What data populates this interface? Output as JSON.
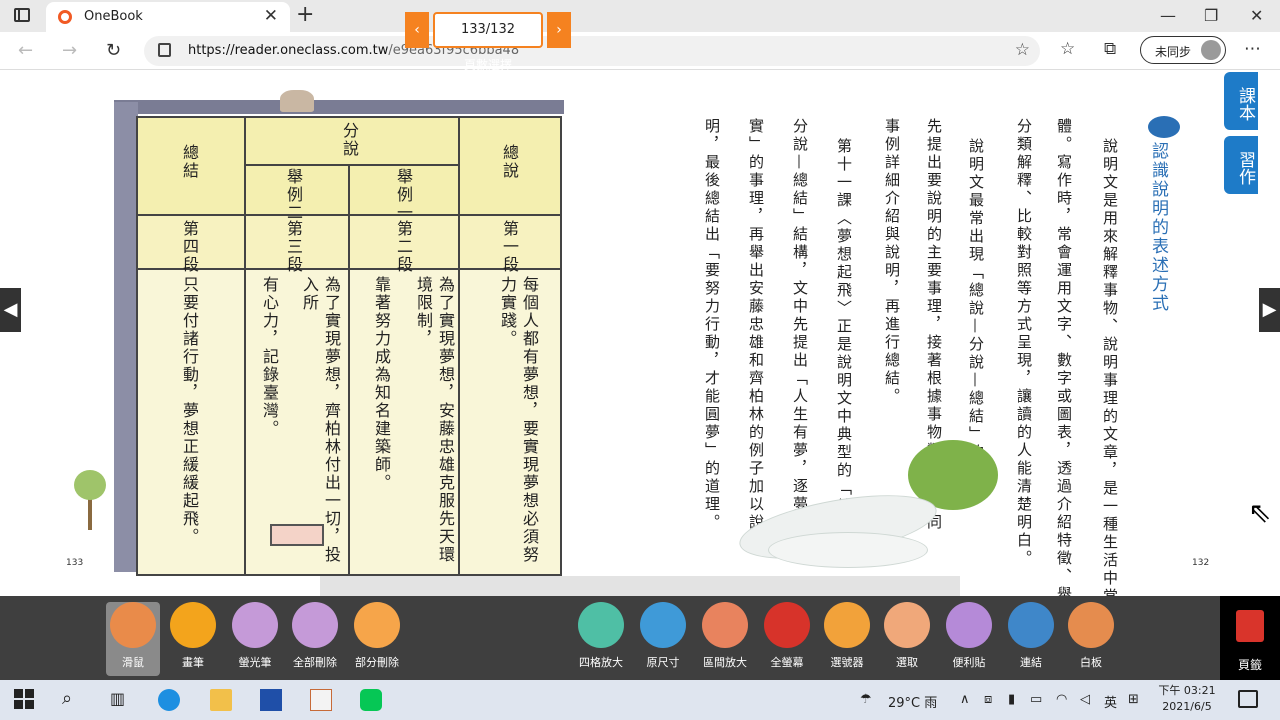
{
  "browser": {
    "tab_title": "OneBook",
    "url_host": "https://reader.oneclass.com.tw",
    "url_path": "/e9ea63f95c6bba48",
    "profile_label": "未同步"
  },
  "reader": {
    "left_page_number": "133",
    "right_page_number": "132",
    "side_tabs": [
      "課本",
      "習作"
    ],
    "table": {
      "headers_top": [
        "總結",
        "分說",
        "總說"
      ],
      "headers_sub": [
        "舉例二",
        "舉例一"
      ],
      "sections": [
        "第四段",
        "第三段",
        "第二段",
        "第一段"
      ],
      "bodies": [
        "只要付諸行動，夢想正緩緩起飛。",
        "有心力，記錄臺灣。",
        "為了實現夢想，齊柏林付出一切，投入所",
        "靠著努力成為知名建築師。",
        "為了實現夢想，安藤忠雄克服先天環境限制，",
        "每個人都有夢想，要實現夢想必須努力實踐。"
      ]
    },
    "heading": "認識說明的表述方式",
    "paragraphs": [
      "說明文是用來解釋事物、說明事理的文章，是一種生活中常見的文",
      "體。寫作時，常會運用文字、數字或圖表，透過介紹特徵、舉例說明、",
      "分類解釋、比較對照等方式呈現，讓讀的人能清楚明白。",
      "說明文最常出現「總說—分說—總結」的結構，",
      "先提出要說明的主要事理，接著根據事物類別或不同",
      "事例詳細介紹與說明，再進行總結。",
      "第十一課〈夢想起飛〉正是說明文中典型的「總說—",
      "分說—總結」結構，文中先提出「人生有夢，逐夢踏",
      "實」的事理，再舉出安藤忠雄和齊柏林的例子加以說",
      "明，最後總結出「要努力行動，才能圓夢」的道理。"
    ]
  },
  "toolbar": {
    "tools_left": [
      {
        "label": "滑鼠",
        "icon": "mouse-icon",
        "color": "#e98b4a"
      },
      {
        "label": "畫筆",
        "icon": "pen-icon",
        "color": "#f3a41c"
      },
      {
        "label": "螢光筆",
        "icon": "highlighter-icon",
        "color": "#c59ad8"
      },
      {
        "label": "全部刪除",
        "icon": "trash-icon",
        "color": "#c59ad8"
      },
      {
        "label": "部分刪除",
        "icon": "eraser-icon",
        "color": "#f6a54a"
      }
    ],
    "page_value": "133/132",
    "page_label": "頁數選擇",
    "tools_right": [
      {
        "label": "四格放大",
        "icon": "grid-zoom-icon",
        "color": "#4fbfa5"
      },
      {
        "label": "原尺寸",
        "icon": "original-size-icon",
        "color": "#3f9ad8"
      },
      {
        "label": "區間放大",
        "icon": "area-zoom-icon",
        "color": "#e8835e"
      },
      {
        "label": "全螢幕",
        "icon": "fullscreen-icon",
        "color": "#d7332a"
      },
      {
        "label": "選號器",
        "icon": "number-picker-icon",
        "color": "#f2a23a"
      },
      {
        "label": "選取",
        "icon": "hand-icon",
        "color": "#f0a87a"
      },
      {
        "label": "便利貼",
        "icon": "sticky-note-icon",
        "color": "#b58ad8"
      },
      {
        "label": "連結",
        "icon": "link-icon",
        "color": "#3f87c9"
      },
      {
        "label": "白板",
        "icon": "whiteboard-icon",
        "color": "#e58c4e"
      }
    ],
    "bookmark_label": "頁籤"
  },
  "taskbar": {
    "weather": "29°C 雨",
    "ime": "英",
    "time": "下午 03:21",
    "date": "2021/6/5"
  }
}
